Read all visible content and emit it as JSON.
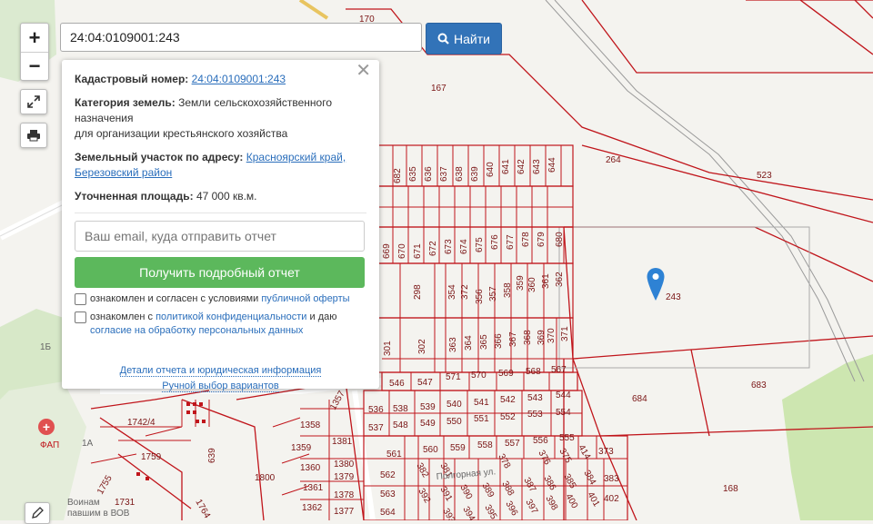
{
  "search": {
    "value": "24:04:0109001:243",
    "button_label": "Найти"
  },
  "popup": {
    "cadastral_label": "Кадастровый номер:",
    "cadastral_value": "24:04:0109001:243",
    "category_label": "Категория земель:",
    "category_value": "Земли сельскохозяйственного назначения",
    "category_value2": "для организации крестьянского хозяйства",
    "address_label": "Земельный участок по адресу:",
    "address_value": "Красноярский край, Березовский район",
    "area_label": "Уточненная площадь:",
    "area_value": "47 000 кв.м.",
    "email_placeholder": "Ваш email, куда отправить отчет",
    "submit_label": "Получить подробный отчет",
    "consent1_text": "ознакомлен и согласен с условиями",
    "consent1_link": "публичной оферты",
    "consent2_text": "ознакомлен с",
    "consent2_link": "политикой конфиденциальности",
    "consent2_and": "и даю",
    "consent2_link2": "согласие на обработку персональных данных",
    "details_link": "Детали отчета и юридическая информация",
    "manual_link": "Ручной выбор вариантов"
  },
  "map": {
    "labels": [
      "170",
      "167",
      "264",
      "523",
      "243",
      "683",
      "684",
      "168",
      "1742/4",
      "1759",
      "639",
      "1800",
      "1358",
      "1357",
      "1359",
      "1381",
      "1360",
      "1380",
      "1379",
      "1361",
      "1378",
      "1362",
      "1377",
      "1755",
      "1731",
      "1764",
      "1Б",
      "1А",
      "ФАП",
      "Воинам павшим в ВОВ",
      "Полгорная ул.",
      "Полгорная ул"
    ],
    "parcels_top": [
      "682",
      "635",
      "636",
      "637",
      "638",
      "639",
      "640",
      "641",
      "642",
      "643",
      "644"
    ],
    "parcels_mid": [
      "669",
      "670",
      "671",
      "672",
      "673",
      "674",
      "675",
      "676",
      "677",
      "678",
      "679",
      "680"
    ],
    "parcels_col": [
      "298",
      "354",
      "372",
      "356",
      "357",
      "358",
      "359",
      "360",
      "361",
      "362"
    ],
    "parcels_row2": [
      "301",
      "302",
      "363",
      "364",
      "365",
      "366",
      "367",
      "368",
      "369",
      "370",
      "371"
    ],
    "parcels_row3": [
      "546",
      "547",
      "571",
      "570",
      "569",
      "568",
      "567"
    ],
    "parcels_row4": [
      "536",
      "538",
      "539",
      "540",
      "541",
      "542",
      "543",
      "544"
    ],
    "parcels_row5": [
      "537",
      "548",
      "549",
      "550",
      "551",
      "552",
      "553",
      "554"
    ],
    "parcels_row6": [
      "561",
      "560",
      "559",
      "558",
      "557",
      "556",
      "555"
    ],
    "parcels_row7": [
      "562",
      "382",
      "381",
      "380",
      "378",
      "376",
      "375",
      "414",
      "373"
    ],
    "parcels_row8": [
      "563",
      "392",
      "391",
      "390",
      "389",
      "388",
      "387",
      "386",
      "385",
      "384",
      "383"
    ],
    "parcels_row9": [
      "564",
      "393",
      "394",
      "395",
      "396",
      "397",
      "398",
      "399",
      "400",
      "401",
      "402"
    ],
    "colors": {
      "parcel_line": "#c0151b",
      "green": "#cfe7b5",
      "road": "#ffffff"
    }
  }
}
